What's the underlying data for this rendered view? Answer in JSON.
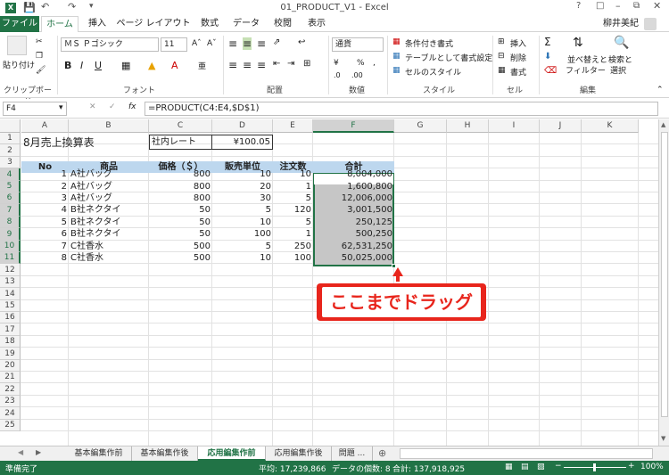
{
  "window": {
    "title": "01_PRODUCT_V1 - Excel",
    "user": "柳井美紀"
  },
  "ribbon_tabs": [
    "ファイル",
    "ホーム",
    "挿入",
    "ページ レイアウト",
    "数式",
    "データ",
    "校閲",
    "表示"
  ],
  "active_tab": "ホーム",
  "clipboard": {
    "paste": "貼り付け",
    "label": "クリップボード"
  },
  "font": {
    "name": "ＭＳ Ｐゴシック",
    "size": "11",
    "label": "フォント"
  },
  "alignment": {
    "label": "配置"
  },
  "number": {
    "format": "通貨",
    "label": "数値"
  },
  "styles": {
    "conditional": "条件付き書式",
    "table": "テーブルとして書式設定",
    "cell": "セルのスタイル",
    "label": "スタイル"
  },
  "cells": {
    "insert": "挿入",
    "delete": "削除",
    "format": "書式",
    "label": "セル"
  },
  "editing": {
    "sort": "並べ替えと フィルター",
    "sort1": "並べ替えと",
    "sort2": "フィルター",
    "find1": "検索と",
    "find2": "選択",
    "label": "編集"
  },
  "formula_bar": {
    "name_box": "F4",
    "fx": "fx",
    "formula": "=PRODUCT(C4:E4,$D$1)"
  },
  "columns": [
    "A",
    "B",
    "C",
    "D",
    "E",
    "F",
    "G",
    "H",
    "I",
    "J",
    "K"
  ],
  "rows": [
    "1",
    "2",
    "3",
    "4",
    "5",
    "6",
    "7",
    "8",
    "9",
    "10",
    "11",
    "12",
    "13",
    "14",
    "15",
    "16",
    "17",
    "18",
    "19",
    "20",
    "21",
    "22",
    "23",
    "24",
    "25"
  ],
  "sheet": {
    "title": "8月売上換算表",
    "rate_label": "社内レート",
    "rate_value": "¥100.05",
    "headers": [
      "No",
      "商品",
      "価格（＄）",
      "販売単位",
      "注文数",
      "合計"
    ],
    "data": [
      [
        "1",
        "A社バッグ",
        "800",
        "10",
        "10",
        "8,004,000"
      ],
      [
        "2",
        "A社バッグ",
        "800",
        "20",
        "1",
        "1,600,800"
      ],
      [
        "3",
        "A社バッグ",
        "800",
        "30",
        "5",
        "12,006,000"
      ],
      [
        "4",
        "B社ネクタイ",
        "50",
        "5",
        "120",
        "3,001,500"
      ],
      [
        "5",
        "B社ネクタイ",
        "50",
        "10",
        "5",
        "250,125"
      ],
      [
        "6",
        "B社ネクタイ",
        "50",
        "100",
        "1",
        "500,250"
      ],
      [
        "7",
        "C社香水",
        "500",
        "5",
        "250",
        "62,531,250"
      ],
      [
        "8",
        "C社香水",
        "500",
        "10",
        "100",
        "50,025,000"
      ]
    ]
  },
  "callout": "ここまでドラッグ",
  "sheet_tabs": [
    "基本編集作前",
    "基本編集作後",
    "応用編集作前",
    "応用編集作後",
    "問題 ..."
  ],
  "active_sheet": "応用編集作前",
  "status": {
    "ready": "準備完了",
    "average": "平均: 17,239,866",
    "count": "データの個数: 8",
    "sum": "合計: 137,918,925",
    "zoom": "100%"
  },
  "colors": {
    "excel_green": "#217346",
    "header_blue": "#bdd7ee",
    "selection_gray": "#c6c6c6",
    "callout_red": "#e8251c"
  }
}
